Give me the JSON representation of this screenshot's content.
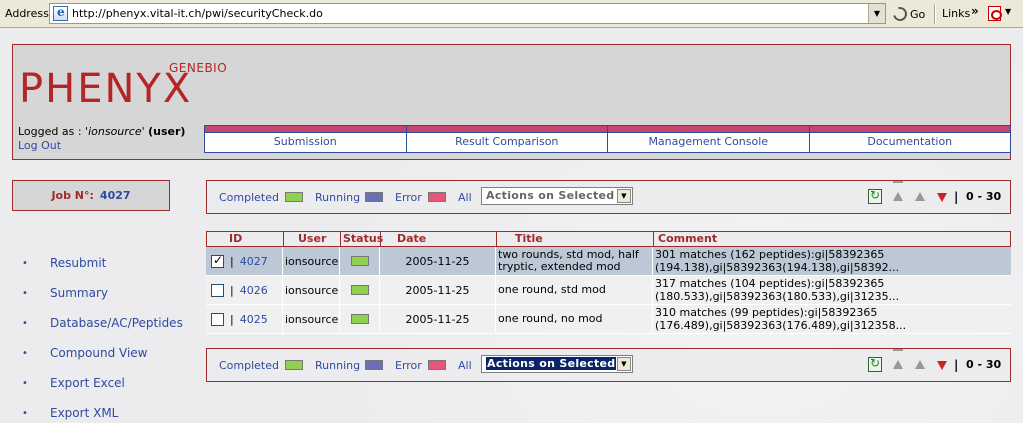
{
  "browser": {
    "address_label": "Address",
    "url": "http://phenyx.vital-it.ch/pwi/securityCheck.do",
    "go_label": "Go",
    "links_label": "Links",
    "chevron": "»"
  },
  "header": {
    "logo_small": "GENEBIO",
    "logo_big": "PHENYX",
    "login_prefix": "Logged as : '",
    "username": "ionsource",
    "login_mid": "' ",
    "role": "(user)",
    "logout": "Log Out"
  },
  "nav": {
    "tabs": [
      {
        "label": "Submission"
      },
      {
        "label": "Result Comparison"
      },
      {
        "label": "Management Console"
      },
      {
        "label": "Documentation"
      }
    ]
  },
  "job": {
    "label": "Job N°:",
    "number": "4027"
  },
  "side_menu": {
    "items": [
      {
        "label": "Resubmit"
      },
      {
        "label": "Summary"
      },
      {
        "label": "Database/AC/Peptides"
      },
      {
        "label": "Compound View"
      },
      {
        "label": "Export Excel"
      },
      {
        "label": "Export XML"
      }
    ]
  },
  "filter": {
    "completed": "Completed",
    "running": "Running",
    "error": "Error",
    "all": "All",
    "actions": "Actions on Selected",
    "range": "0 - 30",
    "pipe": "|",
    "colors": {
      "completed": "#8fd14f",
      "running": "#6a6fb8",
      "error": "#e8557a"
    }
  },
  "table": {
    "headers": {
      "id": "ID",
      "user": "User",
      "status": "Status",
      "date": "Date",
      "title": "Title",
      "comment": "Comment"
    },
    "rows": [
      {
        "checked": true,
        "id": "4027",
        "user": "ionsource",
        "status_color": "#8fd14f",
        "date": "2005-11-25",
        "title": "two rounds, std mod, half tryptic, extended mod",
        "comment": "301 matches (162 peptides):gi|58392365 (194.138),gi|58392363(194.138),gi|58392..."
      },
      {
        "checked": false,
        "id": "4026",
        "user": "ionsource",
        "status_color": "#8fd14f",
        "date": "2005-11-25",
        "title": "one round, std mod",
        "comment": "317 matches (104 peptides):gi|58392365 (180.533),gi|58392363(180.533),gi|31235..."
      },
      {
        "checked": false,
        "id": "4025",
        "user": "ionsource",
        "status_color": "#8fd14f",
        "date": "2005-11-25",
        "title": "one round, no mod",
        "comment": "310 matches (99 peptides):gi|58392365 (176.489),gi|58392363(176.489),gi|312358..."
      }
    ]
  }
}
